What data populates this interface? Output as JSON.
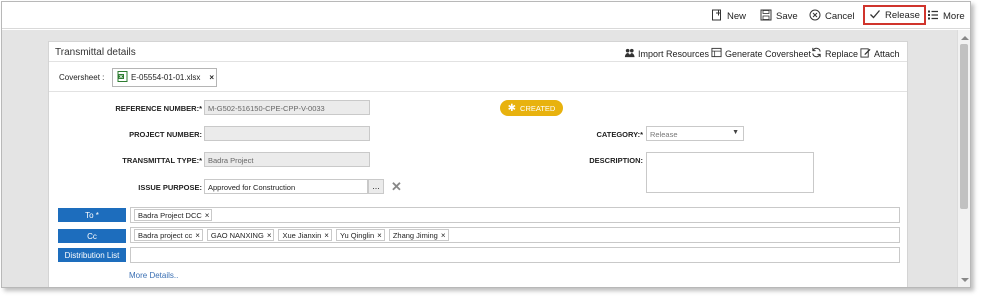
{
  "toolbar": {
    "new_label": "New",
    "save_label": "Save",
    "cancel_label": "Cancel",
    "release_label": "Release",
    "more_label": "More"
  },
  "panel": {
    "title": "Transmittal details",
    "actions": {
      "import_resources": "Import Resources",
      "generate_coversheet": "Generate Coversheet",
      "replace": "Replace",
      "attach": "Attach"
    }
  },
  "coversheet": {
    "label": "Coversheet :",
    "file": "E-05554-01-01.xlsx"
  },
  "form": {
    "reference_number": {
      "label": "REFERENCE NUMBER:*",
      "value": "M-G502-516150-CPE-CPP-V-0033"
    },
    "project_number": {
      "label": "PROJECT NUMBER:",
      "value": ""
    },
    "transmittal_type": {
      "label": "TRANSMITTAL TYPE:*",
      "value": "Badra Project"
    },
    "issue_purpose": {
      "label": "ISSUE PURPOSE:",
      "value": "Approved for Construction",
      "picker": "..."
    },
    "category": {
      "label": "CATEGORY:*",
      "value": "Release"
    },
    "description": {
      "label": "DESCRIPTION:",
      "value": ""
    }
  },
  "status": {
    "label": "CREATED"
  },
  "recipients": {
    "to": {
      "button": "To *",
      "tags": [
        "Badra Project DCC"
      ]
    },
    "cc": {
      "button": "Cc",
      "tags": [
        "Badra project cc",
        "GAO NANXING",
        "Xue Jianxin",
        "Yu Qinglin",
        "Zhang Jiming"
      ]
    },
    "distribution": {
      "button": "Distribution List",
      "tags": []
    }
  },
  "more_details": "More Details..",
  "colors": {
    "primary_button": "#1d6dbd",
    "status_badge": "#e8b20e",
    "release_highlight": "#d0342c",
    "link": "#3a6fb3"
  }
}
